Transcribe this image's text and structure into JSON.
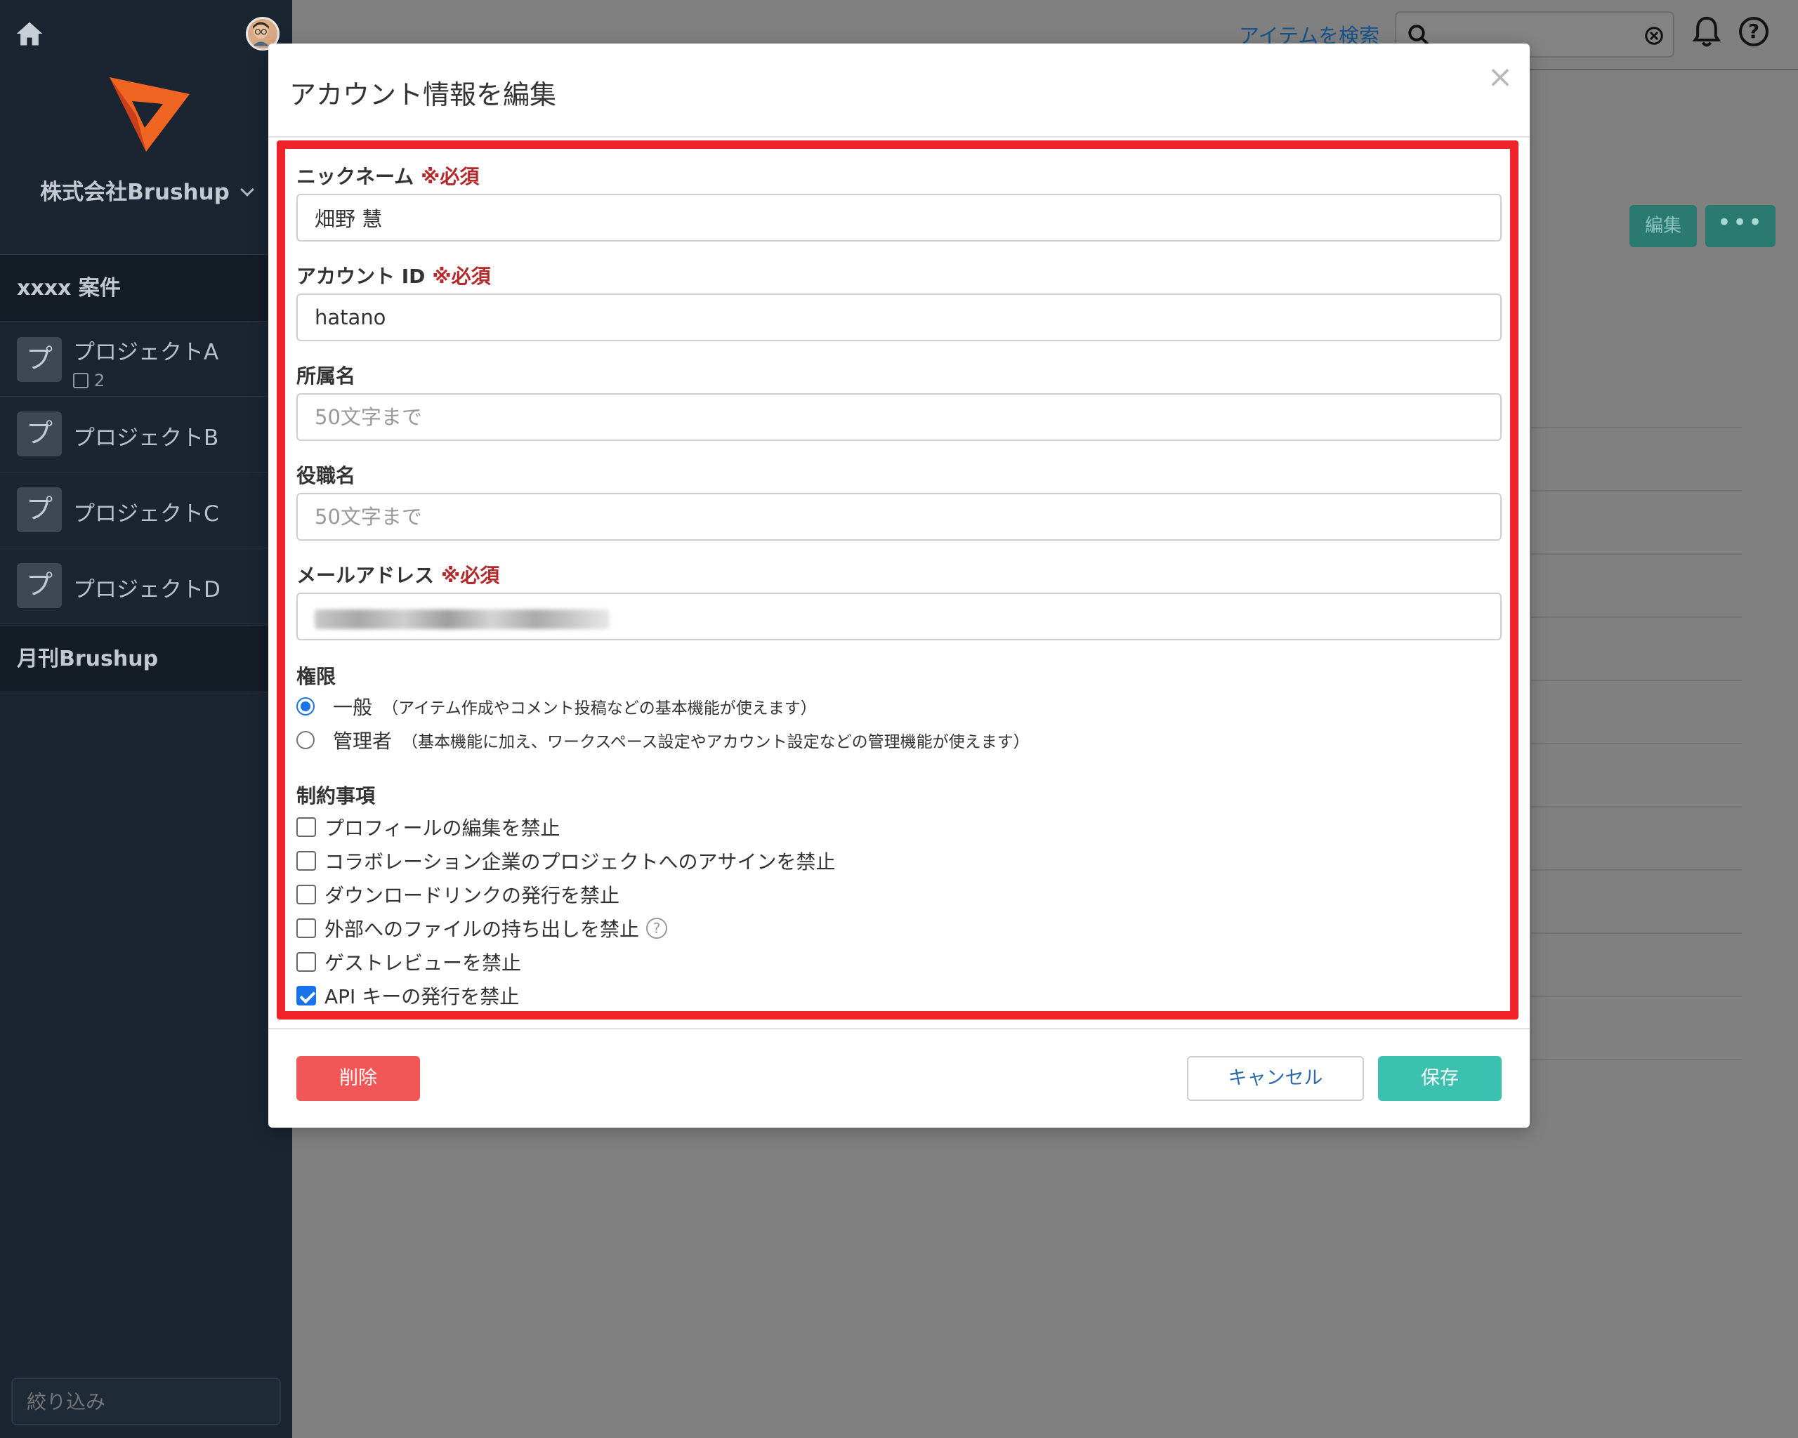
{
  "sidebar": {
    "workspace_name": "株式会社Brushup",
    "section_1": "xxxx 案件",
    "projects": [
      {
        "badge": "プ",
        "name": "プロジェクトA",
        "count": "2"
      },
      {
        "badge": "プ",
        "name": "プロジェクトB"
      },
      {
        "badge": "プ",
        "name": "プロジェクトC"
      },
      {
        "badge": "プ",
        "name": "プロジェクトD"
      }
    ],
    "section_2": "月刊Brushup",
    "filter_placeholder": "絞り込み"
  },
  "header": {
    "search_link": "アイテムを検索",
    "edit_button": "編集",
    "more_button": "•••",
    "help_glyph": "?"
  },
  "modal": {
    "title": "アカウント情報を編集",
    "close_glyph": "×",
    "required_mark": "※必須",
    "nickname": {
      "label": "ニックネーム",
      "value": "畑野 慧"
    },
    "account_id": {
      "label": "アカウント ID",
      "value": "hatano"
    },
    "department": {
      "label": "所属名",
      "placeholder": "50文字まで"
    },
    "position": {
      "label": "役職名",
      "placeholder": "50文字まで"
    },
    "email": {
      "label": "メールアドレス"
    },
    "permission": {
      "label": "権限",
      "options": [
        {
          "label": "一般",
          "desc": "（アイテム作成やコメント投稿などの基本機能が使えます）",
          "checked": true
        },
        {
          "label": "管理者",
          "desc": "（基本機能に加え、ワークスペース設定やアカウント設定などの管理機能が使えます）",
          "checked": false
        }
      ]
    },
    "restrictions": {
      "label": "制約事項",
      "items": [
        {
          "label": "プロフィールの編集を禁止",
          "checked": false
        },
        {
          "label": "コラボレーション企業のプロジェクトへのアサインを禁止",
          "checked": false
        },
        {
          "label": "ダウンロードリンクの発行を禁止",
          "checked": false
        },
        {
          "label": "外部へのファイルの持ち出しを禁止",
          "checked": false
        },
        {
          "label": "ゲストレビューを禁止",
          "checked": false
        },
        {
          "label": "API キーの発行を禁止",
          "checked": true
        }
      ],
      "info_glyph": "?"
    },
    "buttons": {
      "delete": "削除",
      "cancel": "キャンセル",
      "save": "保存"
    }
  },
  "colors": {
    "sidebar_bg": "#1b2532",
    "highlight": "#f0232b",
    "required": "#b5292a",
    "save": "#3cc0b0",
    "delete": "#f25757",
    "accent_blue": "#1a73e8"
  }
}
